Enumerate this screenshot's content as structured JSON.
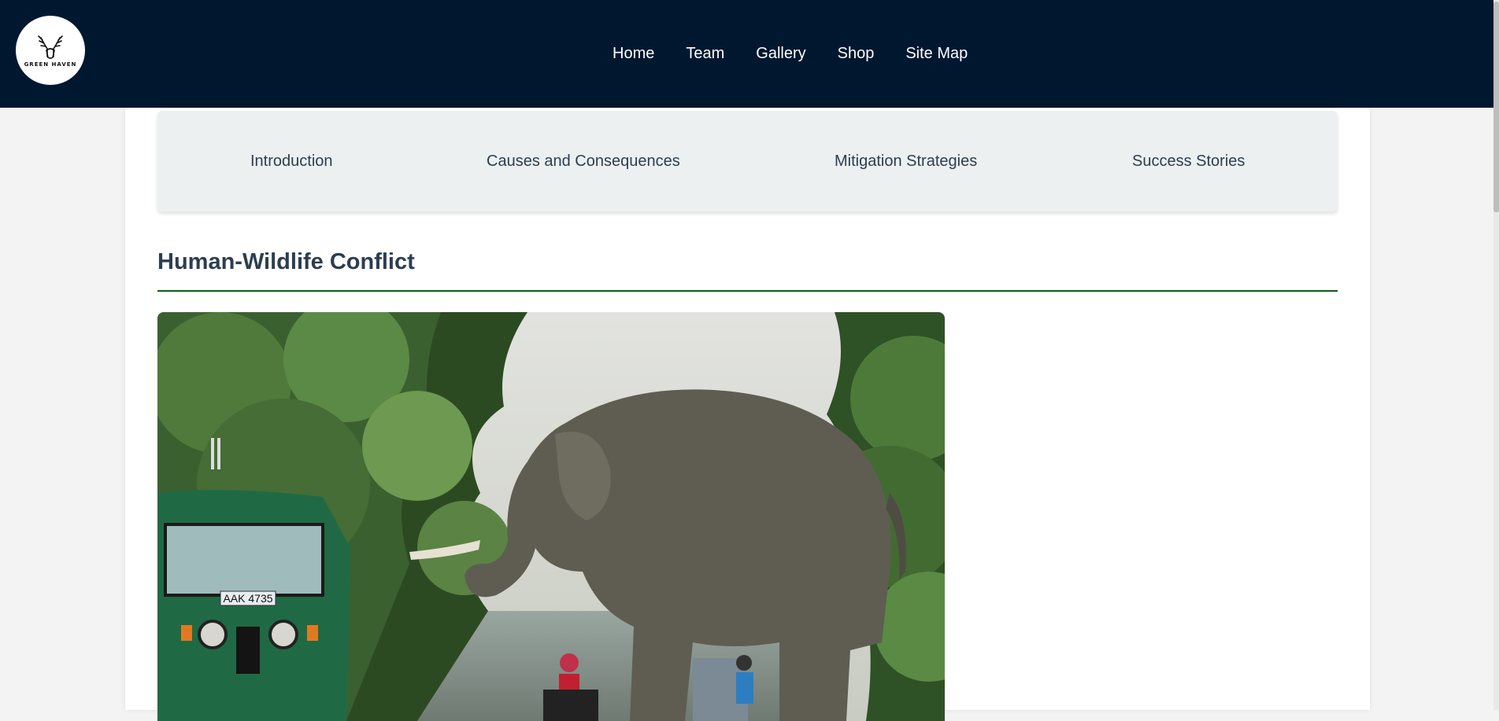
{
  "header": {
    "logo_text": "GREEN HAVEN",
    "nav": [
      "Home",
      "Team",
      "Gallery",
      "Shop",
      "Site Map"
    ]
  },
  "subnav": [
    "Introduction",
    "Causes and Consequences",
    "Mitigation Strategies",
    "Success Stories"
  ],
  "main": {
    "title": "Human-Wildlife Conflict",
    "image_plate_text": "AAK 4735"
  },
  "colors": {
    "header_bg": "#001730",
    "title_color": "#2c3e50",
    "accent_rule": "#0b5a16",
    "subnav_bg": "#ecf0f1"
  }
}
